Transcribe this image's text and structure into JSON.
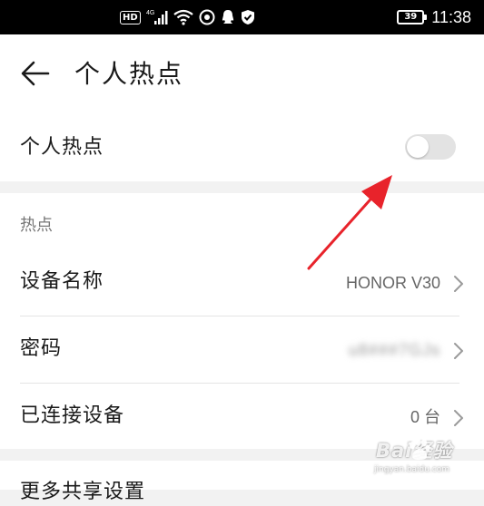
{
  "status_bar": {
    "hd_badge": "HD",
    "network": "4G",
    "battery": "39",
    "time": "11:38"
  },
  "header": {
    "title": "个人热点"
  },
  "hotspot_toggle": {
    "label": "个人热点",
    "enabled": false
  },
  "hotspot_section": {
    "title": "热点",
    "rows": [
      {
        "label": "设备名称",
        "value": "HONOR V30"
      },
      {
        "label": "密码",
        "value": "u8###7GJs"
      },
      {
        "label": "已连接设备",
        "value": "0 台"
      }
    ]
  },
  "more_settings": {
    "partial_label": "更多共享设置"
  },
  "watermark": {
    "brand": "Bai经验",
    "url": "jingyan.baidu.com"
  },
  "colors": {
    "annotation_arrow": "#e8232b",
    "toggle_off": "#e3e3e3",
    "page_background": "#f2f2f2"
  }
}
